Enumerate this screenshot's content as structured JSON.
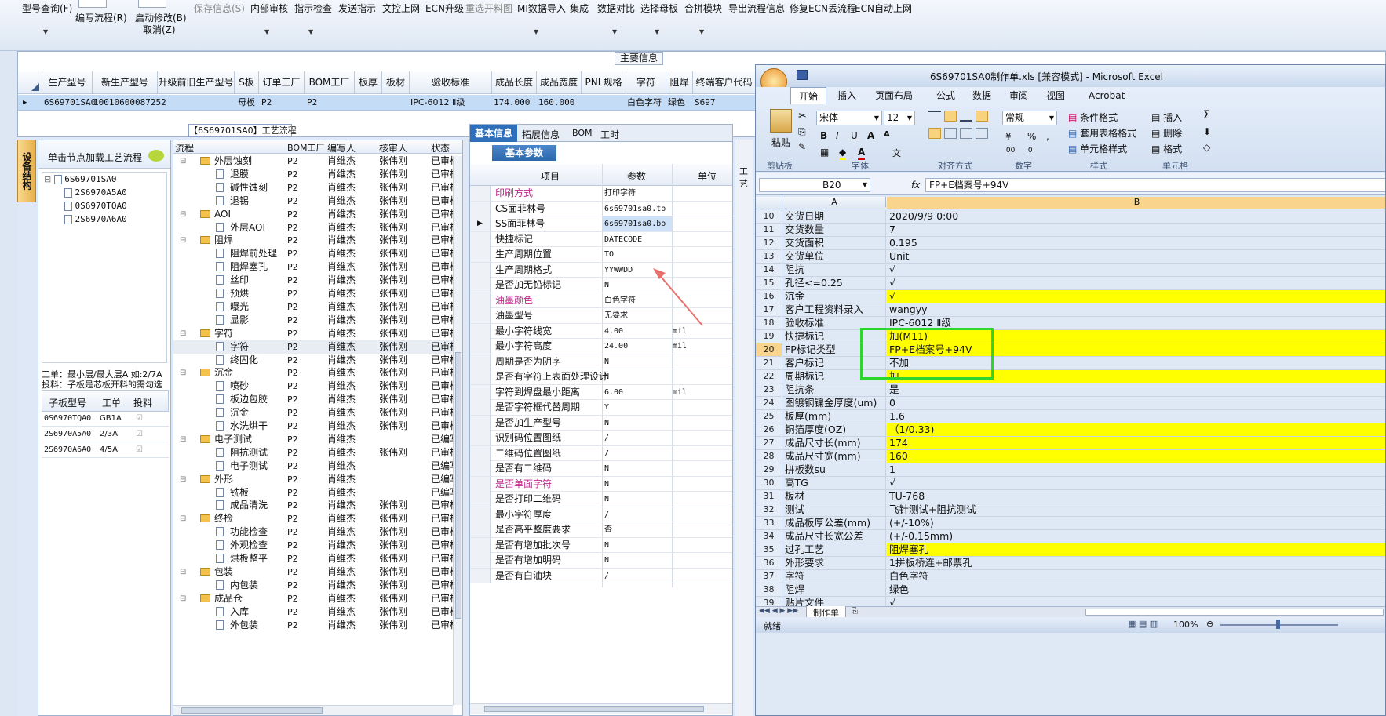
{
  "toolbar": {
    "items": [
      {
        "label": "型号查询(F)",
        "enabled": true
      },
      {
        "label": "编写流程(R)",
        "enabled": true
      },
      {
        "label": "启动修改(B)",
        "enabled": true,
        "sub": "取消(Z)"
      },
      {
        "label": "保存信息(S)",
        "enabled": false
      },
      {
        "label": "内部审核",
        "enabled": true
      },
      {
        "label": "指示检查",
        "enabled": true
      },
      {
        "label": "发送指示",
        "enabled": true
      },
      {
        "label": "文控上网",
        "enabled": true
      },
      {
        "label": "ECN升级",
        "enabled": true
      },
      {
        "label": "重选开料图",
        "enabled": false
      },
      {
        "label": "MI数据导入",
        "enabled": true
      },
      {
        "label": "集成",
        "enabled": true
      },
      {
        "label": "数据对比",
        "enabled": true
      },
      {
        "label": "选择母板",
        "enabled": true
      },
      {
        "label": "合拼模块",
        "enabled": true
      },
      {
        "label": "导出流程信息",
        "enabled": true
      },
      {
        "label": "修复ECN丢流程",
        "enabled": true
      },
      {
        "label": "ECN自动上网",
        "enabled": true
      }
    ]
  },
  "main_info": {
    "caption": "主要信息",
    "columns": [
      "生产型号",
      "新生产型号",
      "升级前旧生产型号",
      "S板",
      "订单工厂",
      "BOM工厂",
      "板厚",
      "板材",
      "验收标准",
      "成品长度",
      "成品宽度",
      "PNL规格",
      "字符",
      "阻焊",
      "终端客户代码"
    ],
    "row": [
      "6S69701SA0",
      "10010600087252",
      "",
      "母板",
      "P2",
      "P2",
      "",
      "",
      "IPC-6012 Ⅱ级",
      "174.000",
      "160.000",
      "",
      "白色字符",
      "绿色",
      "S697"
    ]
  },
  "side_tab": "设备结构",
  "left_panel": {
    "hint": "单击节点加载工艺流程",
    "tree": [
      "6S69701SA0",
      "2S6970A5A0",
      "0S6970TQA0",
      "2S6970A6A0"
    ],
    "note_lines": [
      "工单：最小层/最大层A 如:2/7A",
      "投料：子板是芯板开料的需勾选"
    ],
    "columns": [
      "子板型号",
      "工单",
      "投料"
    ],
    "rows": [
      [
        "0S6970TQA0",
        "GB1A",
        "☑"
      ],
      [
        "2S6970A5A0",
        "2/3A",
        "☑"
      ],
      [
        "2S6970A6A0",
        "4/5A",
        "☑"
      ]
    ]
  },
  "process": {
    "title": "【6S69701SA0】工艺流程",
    "columns": [
      "流程",
      "BOM工厂",
      "编写人",
      "核审人",
      "状态"
    ],
    "rows": [
      {
        "l": 1,
        "n": "外层蚀刻",
        "b": "P2",
        "w": "肖维杰",
        "r": "张伟刚",
        "s": "已审核"
      },
      {
        "l": 2,
        "n": "退膜",
        "b": "P2",
        "w": "肖维杰",
        "r": "张伟刚",
        "s": "已审核"
      },
      {
        "l": 2,
        "n": "碱性蚀刻",
        "b": "P2",
        "w": "肖维杰",
        "r": "张伟刚",
        "s": "已审核"
      },
      {
        "l": 2,
        "n": "退锡",
        "b": "P2",
        "w": "肖维杰",
        "r": "张伟刚",
        "s": "已审核"
      },
      {
        "l": 1,
        "n": "AOI",
        "b": "P2",
        "w": "肖维杰",
        "r": "张伟刚",
        "s": "已审核"
      },
      {
        "l": 2,
        "n": "外层AOI",
        "b": "P2",
        "w": "肖维杰",
        "r": "张伟刚",
        "s": "已审核"
      },
      {
        "l": 1,
        "n": "阻焊",
        "b": "P2",
        "w": "肖维杰",
        "r": "张伟刚",
        "s": "已审核"
      },
      {
        "l": 2,
        "n": "阻焊前处理",
        "b": "P2",
        "w": "肖维杰",
        "r": "张伟刚",
        "s": "已审核"
      },
      {
        "l": 2,
        "n": "阻焊塞孔",
        "b": "P2",
        "w": "肖维杰",
        "r": "张伟刚",
        "s": "已审核"
      },
      {
        "l": 2,
        "n": "丝印",
        "b": "P2",
        "w": "肖维杰",
        "r": "张伟刚",
        "s": "已审核"
      },
      {
        "l": 2,
        "n": "预烘",
        "b": "P2",
        "w": "肖维杰",
        "r": "张伟刚",
        "s": "已审核"
      },
      {
        "l": 2,
        "n": "曝光",
        "b": "P2",
        "w": "肖维杰",
        "r": "张伟刚",
        "s": "已审核"
      },
      {
        "l": 2,
        "n": "显影",
        "b": "P2",
        "w": "肖维杰",
        "r": "张伟刚",
        "s": "已审核"
      },
      {
        "l": 1,
        "n": "字符",
        "b": "P2",
        "w": "肖维杰",
        "r": "张伟刚",
        "s": "已审核"
      },
      {
        "l": 2,
        "n": "字符",
        "b": "P2",
        "w": "肖维杰",
        "r": "张伟刚",
        "s": "已审核"
      },
      {
        "l": 2,
        "n": "终固化",
        "b": "P2",
        "w": "肖维杰",
        "r": "张伟刚",
        "s": "已审核"
      },
      {
        "l": 1,
        "n": "沉金",
        "b": "P2",
        "w": "肖维杰",
        "r": "张伟刚",
        "s": "已审核"
      },
      {
        "l": 2,
        "n": "喷砂",
        "b": "P2",
        "w": "肖维杰",
        "r": "张伟刚",
        "s": "已审核"
      },
      {
        "l": 2,
        "n": "板边包胶",
        "b": "P2",
        "w": "肖维杰",
        "r": "张伟刚",
        "s": "已审核"
      },
      {
        "l": 2,
        "n": "沉金",
        "b": "P2",
        "w": "肖维杰",
        "r": "张伟刚",
        "s": "已审核"
      },
      {
        "l": 2,
        "n": "水洗烘干",
        "b": "P2",
        "w": "肖维杰",
        "r": "张伟刚",
        "s": "已审核"
      },
      {
        "l": 1,
        "n": "电子测试",
        "b": "P2",
        "w": "肖维杰",
        "r": "",
        "s": "已编写"
      },
      {
        "l": 2,
        "n": "阻抗测试",
        "b": "P2",
        "w": "肖维杰",
        "r": "张伟刚",
        "s": "已审核"
      },
      {
        "l": 2,
        "n": "电子测试",
        "b": "P2",
        "w": "肖维杰",
        "r": "",
        "s": "已编写"
      },
      {
        "l": 1,
        "n": "外形",
        "b": "P2",
        "w": "肖维杰",
        "r": "",
        "s": "已编写"
      },
      {
        "l": 2,
        "n": "铣板",
        "b": "P2",
        "w": "肖维杰",
        "r": "",
        "s": "已编写"
      },
      {
        "l": 2,
        "n": "成品清洗",
        "b": "P2",
        "w": "肖维杰",
        "r": "张伟刚",
        "s": "已审核"
      },
      {
        "l": 1,
        "n": "终检",
        "b": "P2",
        "w": "肖维杰",
        "r": "张伟刚",
        "s": "已审核"
      },
      {
        "l": 2,
        "n": "功能检查",
        "b": "P2",
        "w": "肖维杰",
        "r": "张伟刚",
        "s": "已审核"
      },
      {
        "l": 2,
        "n": "外观检查",
        "b": "P2",
        "w": "肖维杰",
        "r": "张伟刚",
        "s": "已审核"
      },
      {
        "l": 2,
        "n": "烘板整平",
        "b": "P2",
        "w": "肖维杰",
        "r": "张伟刚",
        "s": "已审核"
      },
      {
        "l": 1,
        "n": "包装",
        "b": "P2",
        "w": "肖维杰",
        "r": "张伟刚",
        "s": "已审核"
      },
      {
        "l": 2,
        "n": "内包装",
        "b": "P2",
        "w": "肖维杰",
        "r": "张伟刚",
        "s": "已审核"
      },
      {
        "l": 1,
        "n": "成品仓",
        "b": "P2",
        "w": "肖维杰",
        "r": "张伟刚",
        "s": "已审核"
      },
      {
        "l": 2,
        "n": "入库",
        "b": "P2",
        "w": "肖维杰",
        "r": "张伟刚",
        "s": "已审核"
      },
      {
        "l": 2,
        "n": "外包装",
        "b": "P2",
        "w": "肖维杰",
        "r": "张伟刚",
        "s": "已审核"
      }
    ]
  },
  "info": {
    "tabs": [
      "基本信息",
      "拓展信息",
      "BOM",
      "工时"
    ],
    "subtab": "基本参数",
    "columns": [
      "项目",
      "参数",
      "单位"
    ],
    "rows": [
      {
        "k": "印刷方式",
        "v": "打印字符",
        "u": "",
        "pink": true
      },
      {
        "k": "CS面菲林号",
        "v": "6s69701sa0.to",
        "u": ""
      },
      {
        "k": "SS面菲林号",
        "v": "6s69701sa0.bo",
        "u": "",
        "sel": true
      },
      {
        "k": "快捷标记",
        "v": "DATECODE",
        "u": ""
      },
      {
        "k": "生产周期位置",
        "v": "TO",
        "u": ""
      },
      {
        "k": "生产周期格式",
        "v": "YYWWDD",
        "u": ""
      },
      {
        "k": "是否加无铅标记",
        "v": "N",
        "u": ""
      },
      {
        "k": "油墨颜色",
        "v": "白色字符",
        "u": "",
        "pink": true
      },
      {
        "k": "油墨型号",
        "v": "无要求",
        "u": ""
      },
      {
        "k": "最小字符线宽",
        "v": "4.00",
        "u": "mil"
      },
      {
        "k": "最小字符高度",
        "v": "24.00",
        "u": "mil"
      },
      {
        "k": "周期是否为阴字",
        "v": "N",
        "u": ""
      },
      {
        "k": "是否有字符上表面处理设计",
        "v": "N",
        "u": ""
      },
      {
        "k": "字符到焊盘最小距离",
        "v": "6.00",
        "u": "mil"
      },
      {
        "k": "是否字符框代替周期",
        "v": "Y",
        "u": ""
      },
      {
        "k": "是否加生产型号",
        "v": "N",
        "u": ""
      },
      {
        "k": "识别码位置图纸",
        "v": "/",
        "u": ""
      },
      {
        "k": "二维码位置图纸",
        "v": "/",
        "u": ""
      },
      {
        "k": "是否有二维码",
        "v": "N",
        "u": ""
      },
      {
        "k": "是否单面字符",
        "v": "N",
        "u": "",
        "pink": true
      },
      {
        "k": "是否打印二维码",
        "v": "N",
        "u": ""
      },
      {
        "k": "最小字符厚度",
        "v": "/",
        "u": ""
      },
      {
        "k": "是否高平整度要求",
        "v": "否",
        "u": ""
      },
      {
        "k": "是否有增加批次号",
        "v": "N",
        "u": ""
      },
      {
        "k": "是否有增加明码",
        "v": "N",
        "u": ""
      },
      {
        "k": "是否有白油块",
        "v": "/",
        "u": ""
      }
    ]
  },
  "excel": {
    "title": "6S69701SA0制作单.xls [兼容模式] - Microsoft Excel",
    "tabs": [
      "开始",
      "插入",
      "页面布局",
      "公式",
      "数据",
      "审阅",
      "视图",
      "Acrobat"
    ],
    "font_name": "宋体",
    "font_size": "12",
    "number_format": "常规",
    "group_labels": [
      "剪贴板",
      "字体",
      "对齐方式",
      "数字",
      "样式",
      "单元格"
    ],
    "style_buttons": [
      "条件格式",
      "套用表格格式",
      "单元格样式"
    ],
    "cell_buttons": [
      "插入",
      "删除",
      "格式"
    ],
    "paste_label": "粘贴",
    "name_box": "B20",
    "formula": "FP+E档案号+94V",
    "col_headers": [
      "A",
      "B"
    ],
    "rows": [
      {
        "n": "10",
        "a": "交货日期",
        "b": "2020/9/9 0:00",
        "y": false
      },
      {
        "n": "11",
        "a": "交货数量",
        "b": "7",
        "y": false
      },
      {
        "n": "12",
        "a": "交货面积",
        "b": "0.195",
        "y": false
      },
      {
        "n": "13",
        "a": "交货单位",
        "b": "Unit",
        "y": false
      },
      {
        "n": "14",
        "a": "阻抗",
        "b": "√",
        "y": false
      },
      {
        "n": "15",
        "a": "孔径<=0.25",
        "b": "√",
        "y": false
      },
      {
        "n": "16",
        "a": "沉金",
        "b": "√",
        "y": true
      },
      {
        "n": "17",
        "a": "客户工程资料录入",
        "b": "wangyy",
        "y": false
      },
      {
        "n": "18",
        "a": "验收标准",
        "b": "IPC-6012 Ⅱ级",
        "y": false
      },
      {
        "n": "19",
        "a": "快捷标记",
        "b": "加(M11)",
        "y": true
      },
      {
        "n": "20",
        "a": "FP标记类型",
        "b": "FP+E档案号+94V",
        "y": true
      },
      {
        "n": "21",
        "a": "客户标记",
        "b": "不加",
        "y": false
      },
      {
        "n": "22",
        "a": "周期标记",
        "b": "加",
        "y": true
      },
      {
        "n": "23",
        "a": "阻抗条",
        "b": "是",
        "y": false
      },
      {
        "n": "24",
        "a": "图镀铜镍金厚度(um)",
        "b": "0",
        "y": false
      },
      {
        "n": "25",
        "a": "板厚(mm)",
        "b": "1.6",
        "y": false
      },
      {
        "n": "26",
        "a": "铜箔厚度(OZ)",
        "b": "（1/0.33)",
        "y": true
      },
      {
        "n": "27",
        "a": "成品尺寸长(mm)",
        "b": "174",
        "y": true
      },
      {
        "n": "28",
        "a": "成品尺寸宽(mm)",
        "b": "160",
        "y": true
      },
      {
        "n": "29",
        "a": "拼板数su",
        "b": "1",
        "y": false
      },
      {
        "n": "30",
        "a": "高TG",
        "b": "√",
        "y": false
      },
      {
        "n": "31",
        "a": "板材",
        "b": "TU-768",
        "y": false
      },
      {
        "n": "32",
        "a": "测试",
        "b": "飞针测试+阻抗测试",
        "y": false
      },
      {
        "n": "33",
        "a": "成品板厚公差(mm)",
        "b": "(+/-10%)",
        "y": false
      },
      {
        "n": "34",
        "a": "成品尺寸长宽公差",
        "b": "(+/-0.15mm)",
        "y": false
      },
      {
        "n": "35",
        "a": "过孔工艺",
        "b": "阻焊塞孔",
        "y": true
      },
      {
        "n": "36",
        "a": "外形要求",
        "b": "1拼板桥连+邮票孔",
        "y": false
      },
      {
        "n": "37",
        "a": "字符",
        "b": "白色字符",
        "y": false
      },
      {
        "n": "38",
        "a": "阻焊",
        "b": "绿色",
        "y": false
      },
      {
        "n": "39",
        "a": "贴片文件",
        "b": "√",
        "y": false
      }
    ],
    "sheet_tab": "制作单",
    "status": "就绪",
    "zoom": "100%"
  },
  "colors": {
    "highlight_box": "#2dd62d",
    "arrow": "#e8706c",
    "yellow": "#ffff00",
    "pink_label": "#c0268c"
  }
}
